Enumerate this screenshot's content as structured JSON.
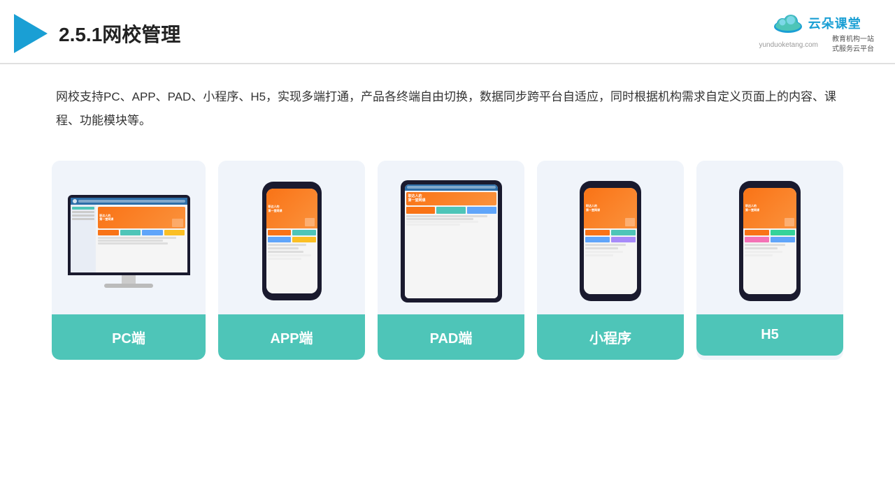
{
  "header": {
    "title": "2.5.1网校管理",
    "logo_name": "云朵课堂",
    "logo_pinyin": "yunduoketang.com",
    "logo_tagline": "教育机构一站\n式服务云平台"
  },
  "description": "网校支持PC、APP、PAD、小程序、H5，实现多端打通，产品各终端自由切换，数据同步跨平台自适应，同时根据机构需求自定义页面上的内容、课程、功能模块等。",
  "cards": [
    {
      "id": "pc",
      "label": "PC端",
      "device": "monitor"
    },
    {
      "id": "app",
      "label": "APP端",
      "device": "phone-tall"
    },
    {
      "id": "pad",
      "label": "PAD端",
      "device": "tablet"
    },
    {
      "id": "miniprogram",
      "label": "小程序",
      "device": "phone"
    },
    {
      "id": "h5",
      "label": "H5",
      "device": "phone"
    }
  ],
  "colors": {
    "teal": "#4ec5b8",
    "accent_orange": "#f97316",
    "dark_bg": "#1a1a2e",
    "card_bg": "#eef2f9"
  }
}
